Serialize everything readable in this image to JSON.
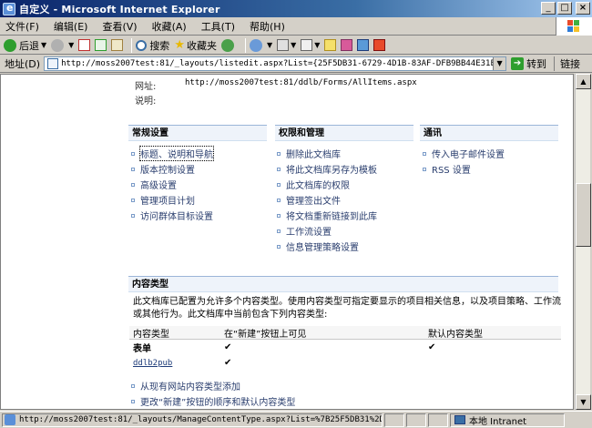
{
  "window": {
    "title": "自定义 - Microsoft Internet Explorer",
    "min": "_",
    "max": "□",
    "close": "×"
  },
  "menu": [
    "文件(F)",
    "编辑(E)",
    "查看(V)",
    "收藏(A)",
    "工具(T)",
    "帮助(H)"
  ],
  "toolbar": {
    "back": "后退",
    "search": "搜索",
    "favorites": "收藏夹"
  },
  "address": {
    "label": "地址(D)",
    "url": "http://moss2007test:81/_layouts/listedit.aspx?List={25F5DB31-6729-4D1B-83AF-DFB9BB44E31E}",
    "go": "转到",
    "links": "链接"
  },
  "info": {
    "url_label": "网址:",
    "url_value": "http://moss2007test:81/ddlb/Forms/AllItems.aspx",
    "desc_label": "说明:"
  },
  "sections": {
    "general": {
      "title": "常规设置",
      "items": [
        "标题、说明和导航",
        "版本控制设置",
        "高级设置",
        "管理项目计划",
        "访问群体目标设置"
      ]
    },
    "permissions": {
      "title": "权限和管理",
      "items": [
        "删除此文档库",
        "将此文档库另存为模板",
        "此文档库的权限",
        "管理签出文件",
        "将文档重新链接到此库",
        "工作流设置",
        "信息管理策略设置"
      ]
    },
    "communications": {
      "title": "通讯",
      "items": [
        "传入电子邮件设置",
        "RSS 设置"
      ]
    }
  },
  "content_types": {
    "title": "内容类型",
    "description": "此文档库已配置为允许多个内容类型。使用内容类型可指定要显示的项目相关信息，以及项目策略、工作流或其他行为。此文档库中当前包含下列内容类型:",
    "columns": [
      "内容类型",
      "在“新建”按钮上可见",
      "默认内容类型"
    ],
    "rows": [
      {
        "name": "表单",
        "visible": "✔",
        "default": "✔"
      },
      {
        "name": "ddlb2pub",
        "visible": "✔",
        "default": ""
      }
    ],
    "actions": [
      "从现有网站内容类型添加",
      "更改“新建”按钮的顺序和默认内容类型"
    ]
  },
  "status": {
    "url": "http://moss2007test:81/_layouts/ManageContentType.aspx?List=%7B25F5DB31%2D6729%",
    "zone": "本地 Intranet"
  }
}
